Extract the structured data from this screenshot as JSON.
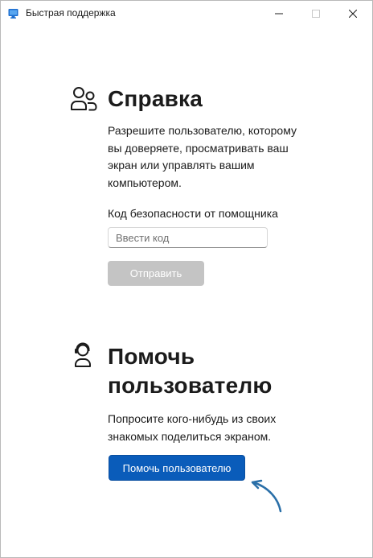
{
  "window": {
    "title": "Быстрая поддержка"
  },
  "get_help": {
    "heading": "Справка",
    "description": "Разрешите пользователю, которому вы доверяете, просматривать ваш экран или управлять вашим компьютером.",
    "field_label": "Код безопасности от помощника",
    "input_placeholder": "Ввести код",
    "input_value": "",
    "submit_label": "Отправить",
    "icon": "people-icon"
  },
  "give_help": {
    "heading": "Помочь пользователю",
    "description": "Попросите кого-нибудь из своих знакомых поделиться экраном.",
    "button_label": "Помочь пользователю",
    "icon": "headset-person-icon"
  },
  "colors": {
    "accent": "#0a5cba",
    "disabled_button": "#c4c4c4",
    "annotation_arrow": "#2a6fa8"
  }
}
